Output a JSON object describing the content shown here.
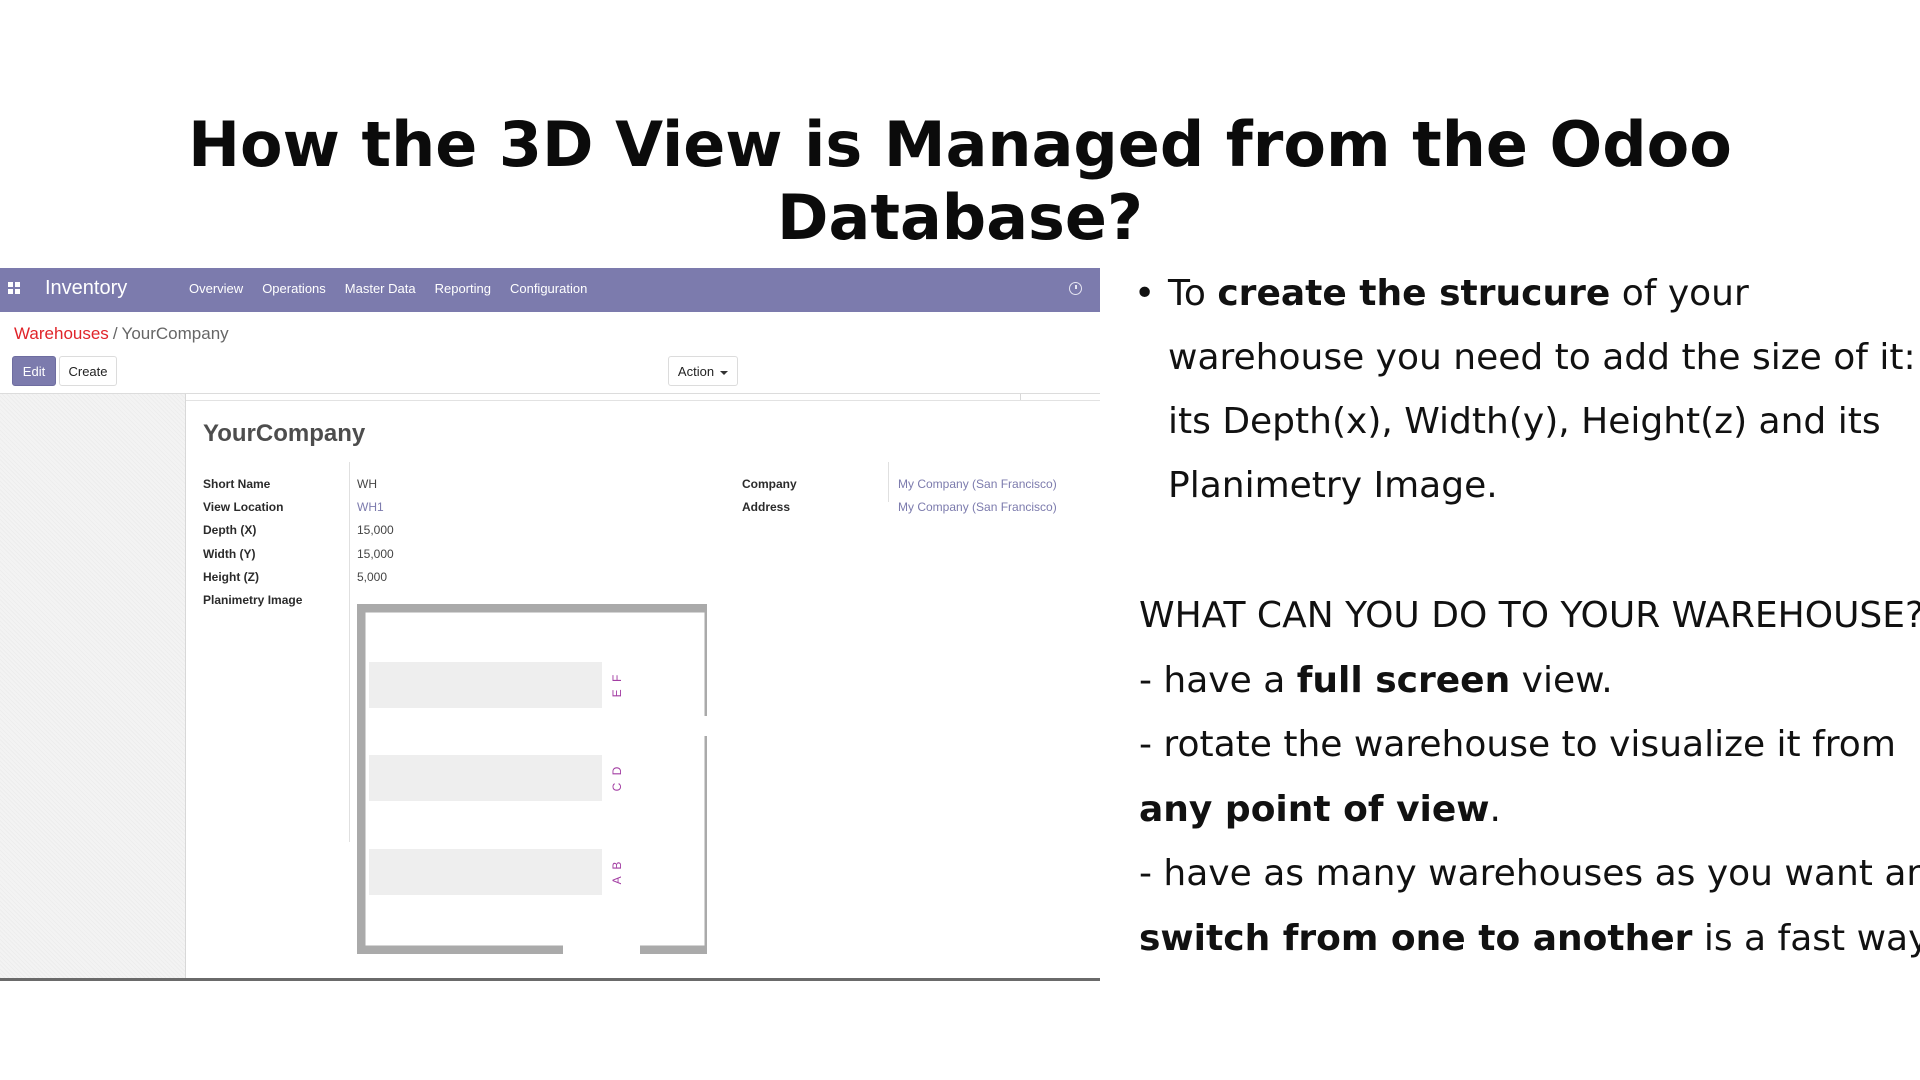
{
  "slide": {
    "title": "How the 3D View is Managed from the Odoo Database?"
  },
  "odoo": {
    "app_name": "Inventory",
    "menu": [
      "Overview",
      "Operations",
      "Master Data",
      "Reporting",
      "Configuration"
    ],
    "breadcrumb": {
      "parent": "Warehouses",
      "separator": "/",
      "current": "YourCompany"
    },
    "buttons": {
      "edit": "Edit",
      "create": "Create",
      "action": "Action"
    },
    "record": {
      "title": "YourCompany",
      "fields": {
        "short_name": {
          "label": "Short Name",
          "value": "WH"
        },
        "view_location": {
          "label": "View Location",
          "value": "WH1"
        },
        "depth": {
          "label": "Depth (X)",
          "value": "15,000"
        },
        "width": {
          "label": "Width (Y)",
          "value": "15,000"
        },
        "height": {
          "label": "Height (Z)",
          "value": "5,000"
        },
        "planimetry": {
          "label": "Planimetry Image"
        },
        "company": {
          "label": "Company",
          "value": "My Company (San Francisco)"
        },
        "address": {
          "label": "Address",
          "value": "My Company (San Francisco)"
        }
      },
      "planimetry_labels": [
        "E F",
        "C D",
        "A B"
      ]
    },
    "colors": {
      "topbar": "#7c7bad",
      "link_red": "#e0242a",
      "link_purple": "#7c7bad"
    }
  },
  "right": {
    "bullet": {
      "pre": "To ",
      "bold": "create the strucure",
      "rest1": " of your",
      "line2": "warehouse you need to add the size of it:",
      "line3": "its Depth(x), Width(y), Height(z) and its",
      "line4": "Planimetry Image."
    },
    "heading": "WHAT CAN YOU DO TO YOUR WAREHOUSE?",
    "item1": {
      "pre": "- have a ",
      "bold": "full screen",
      "post": " view."
    },
    "item2": {
      "line1": "- rotate the warehouse to visualize it from",
      "bold": "any point of view",
      "post": "."
    },
    "item3": {
      "line1": "- have as many warehouses as you want and",
      "bold": "switch from one to another",
      "post": " is a fast way."
    }
  }
}
